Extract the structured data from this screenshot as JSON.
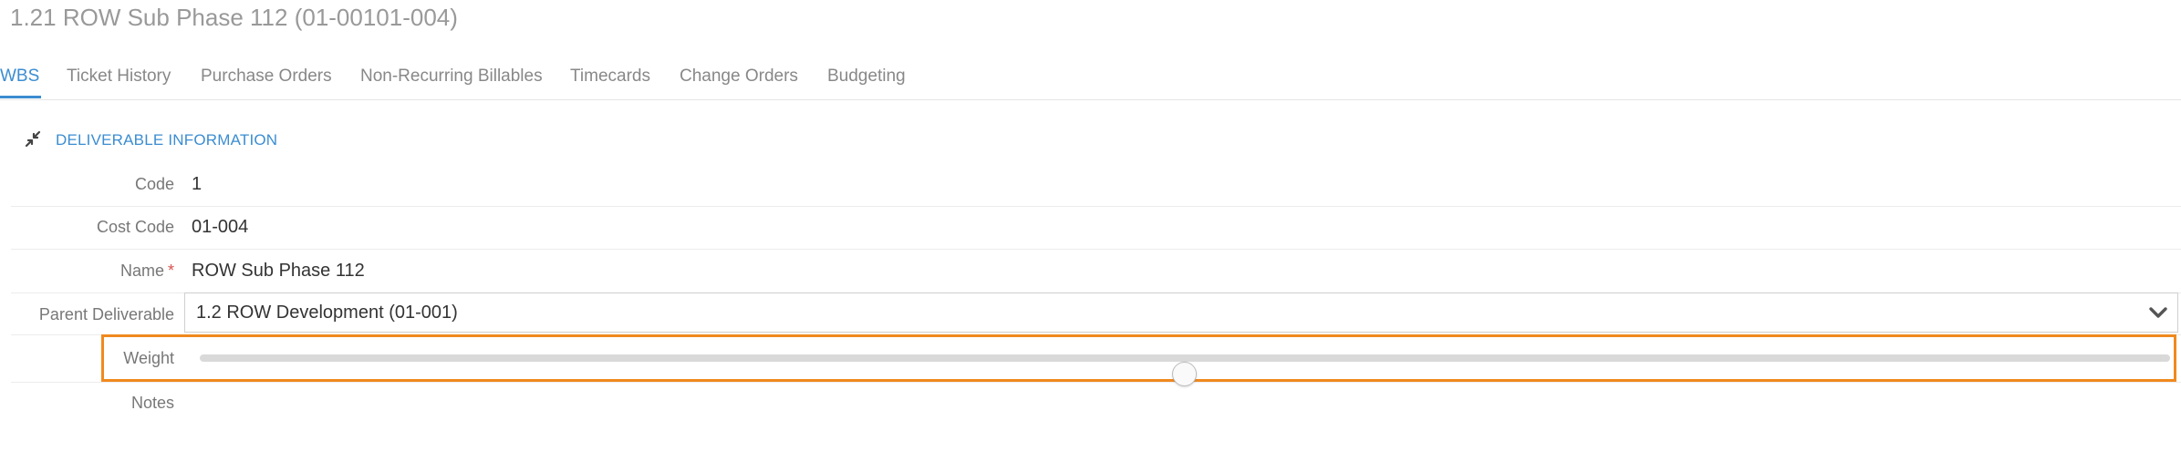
{
  "page": {
    "title": "1.21 ROW Sub Phase 112 (01-00101-004)"
  },
  "tabs": [
    {
      "label": "WBS",
      "active": true
    },
    {
      "label": "Ticket History",
      "active": false
    },
    {
      "label": "Purchase Orders",
      "active": false
    },
    {
      "label": "Non-Recurring Billables",
      "active": false
    },
    {
      "label": "Timecards",
      "active": false
    },
    {
      "label": "Change Orders",
      "active": false
    },
    {
      "label": "Budgeting",
      "active": false
    }
  ],
  "section": {
    "title": "DELIVERABLE INFORMATION",
    "icon": "collapse-icon"
  },
  "fields": {
    "code": {
      "label": "Code",
      "value": "1"
    },
    "cost_code": {
      "label": "Cost Code",
      "value": "01-004"
    },
    "name": {
      "label": "Name",
      "value": "ROW Sub Phase 112",
      "required_mark": "*"
    },
    "parent": {
      "label": "Parent Deliverable",
      "value": "1.2 ROW Development (01-001)"
    },
    "weight": {
      "label": "Weight",
      "value_fraction": 0.5
    },
    "notes": {
      "label": "Notes",
      "value": ""
    }
  },
  "colors": {
    "accent": "#3b8dd1",
    "highlight": "#f0891e",
    "required": "#d9534f"
  }
}
